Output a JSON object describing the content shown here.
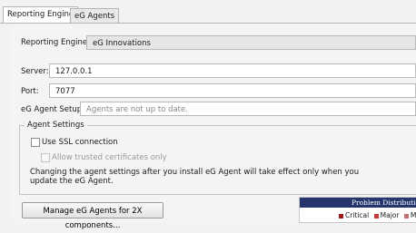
{
  "tabs": [
    {
      "label": "Reporting Engine",
      "active": true
    },
    {
      "label": "eG Agents",
      "active": false
    }
  ],
  "form": {
    "reporting_engine_label": "Reporting Engine:",
    "reporting_engine_value": "eG Innovations",
    "server_label": "Server:",
    "server_value": "127.0.0.1",
    "port_label": "Port:",
    "port_value": "7077",
    "agent_setups_label": "eG Agent Setups:",
    "agent_setups_placeholder": "Agents are not up to date."
  },
  "agent_settings": {
    "title": "Agent Settings",
    "use_ssl_label": "Use SSL connection",
    "use_ssl_checked": false,
    "allow_trusted_label": "Allow trusted certificates only",
    "allow_trusted_checked": false,
    "note_line1": "Changing the agent settings after you install eG Agent will take effect only when you",
    "note_line2": "update the eG Agent."
  },
  "manage_button_label": "Manage eG Agents for 2X components...",
  "problem_chart": {
    "title": "Problem Distributio",
    "legend": [
      {
        "label": "Critical",
        "color": "#9b1b1b"
      },
      {
        "label": "Major",
        "color": "#c23a3a"
      },
      {
        "label": "M",
        "color": "#c07070"
      }
    ]
  }
}
